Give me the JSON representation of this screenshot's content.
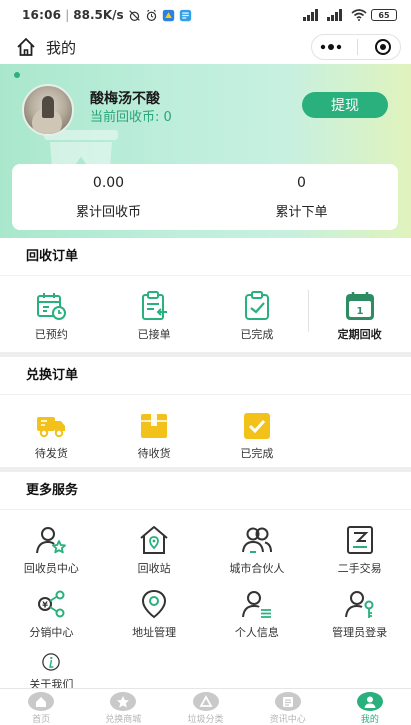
{
  "status_bar": {
    "time": "16:06",
    "speed": "88.5K/s",
    "battery": "65"
  },
  "nav": {
    "title": "我的"
  },
  "profile": {
    "username": "酸梅汤不酸",
    "coins_label": "当前回收币: 0",
    "withdraw_label": "提现"
  },
  "stats": [
    {
      "value": "0.00",
      "label": "累计回收币"
    },
    {
      "value": "0",
      "label": "累计下单"
    }
  ],
  "recycle_orders": {
    "title": "回收订单",
    "items": [
      {
        "label": "已预约",
        "icon": "calendar-clock-icon"
      },
      {
        "label": "已接单",
        "icon": "clipboard-return-icon"
      },
      {
        "label": "已完成",
        "icon": "clipboard-check-icon"
      },
      {
        "label": "定期回收",
        "icon": "calendar-one-icon"
      }
    ]
  },
  "exchange_orders": {
    "title": "兑换订单",
    "items": [
      {
        "label": "待发货",
        "icon": "delivery-truck-icon"
      },
      {
        "label": "待收货",
        "icon": "package-box-icon"
      },
      {
        "label": "已完成",
        "icon": "check-box-icon"
      }
    ]
  },
  "more_services": {
    "title": "更多服务",
    "items": [
      {
        "label": "回收员中心",
        "icon": "user-star-icon"
      },
      {
        "label": "回收站",
        "icon": "station-house-icon"
      },
      {
        "label": "城市合伙人",
        "icon": "partners-icon"
      },
      {
        "label": "二手交易",
        "icon": "secondhand-trade-icon"
      },
      {
        "label": "分销中心",
        "icon": "distribution-share-icon"
      },
      {
        "label": "地址管理",
        "icon": "location-pin-icon"
      },
      {
        "label": "个人信息",
        "icon": "user-info-icon"
      },
      {
        "label": "管理员登录",
        "icon": "admin-key-icon"
      },
      {
        "label": "关于我们",
        "icon": "info-icon"
      }
    ]
  },
  "tab_bar": {
    "active": 4,
    "items": [
      {
        "label": "首页",
        "icon": "home-icon"
      },
      {
        "label": "兑换商城",
        "icon": "star-icon"
      },
      {
        "label": "垃圾分类",
        "icon": "recycle-icon"
      },
      {
        "label": "资讯中心",
        "icon": "news-icon"
      },
      {
        "label": "我的",
        "icon": "profile-icon"
      }
    ]
  },
  "colors": {
    "accent": "#29b07c",
    "accent_text": "#2aa479",
    "hero_start": "#a9e7cc",
    "hero_end": "#e0f3bd",
    "exchange_icon": "#f2c21b",
    "tab_inactive": "#c9c9c9"
  }
}
